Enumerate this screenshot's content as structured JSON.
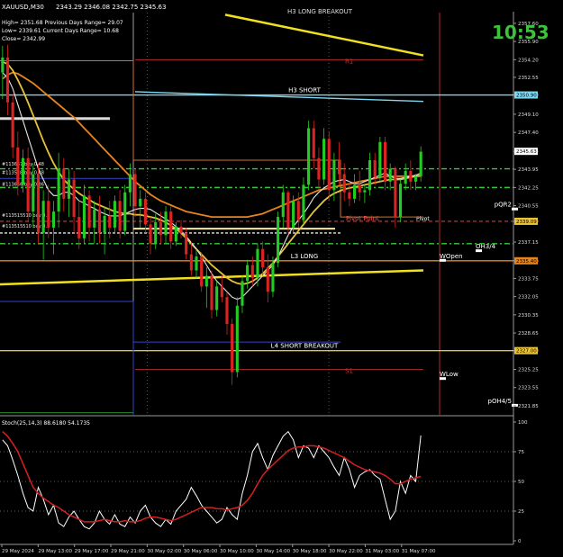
{
  "window": {
    "title": "XAUUSD,M30",
    "ohlc": "2343.29 2346.08 2342.75 2345.63",
    "clock": "10:53"
  },
  "info": {
    "lines": [
      "High= 2351.68   Previous Days Range= 29.07",
      "Low= 2339.61   Current Days Range= 10.68",
      "Close= 2342.99"
    ]
  },
  "colors": {
    "background": "#000000",
    "bull": "#22cc22",
    "bear": "#dd2222",
    "ma_orange": "#e8841e",
    "ma_gold": "#e8c23a",
    "ma_white": "#e6e6e6",
    "yellow_line": "#f0e020",
    "cyan_line": "#7fd8f0",
    "green_dash": "#33cc33",
    "stoch_main": "#ffffff",
    "stoch_signal": "#d42020"
  },
  "chart_data": [
    {
      "type": "line",
      "title": "XAUUSD,M30",
      "x_tick_labels": [
        "29 May 2024",
        "29 May 13:00",
        "29 May 17:00",
        "29 May 21:00",
        "30 May 02:00",
        "30 May 06:00",
        "30 May 10:00",
        "30 May 14:00",
        "30 May 18:00",
        "30 May 22:00",
        "31 May 03:00",
        "31 May 07:00"
      ],
      "y_ticks": [
        "2357.60",
        "2355.90",
        "2354.20",
        "2352.55",
        "2350.90",
        "2349.10",
        "2347.40",
        "2345.63",
        "2343.95",
        "2342.25",
        "2340.55",
        "2339.09",
        "2337.15",
        "2335.40",
        "2333.75",
        "2332.05",
        "2330.35",
        "2328.65",
        "2327.00",
        "2325.25",
        "2323.55",
        "2321.85"
      ],
      "ylim": [
        2321.0,
        2358.6
      ],
      "price_tags": [
        {
          "value": 2350.9,
          "label": "2350.90",
          "color": "#7fd8f0"
        },
        {
          "value": 2345.63,
          "label": "2345.63",
          "color": "#ffffff"
        },
        {
          "value": 2339.09,
          "label": "2339.09",
          "color": "#e8c23a"
        },
        {
          "value": 2335.4,
          "label": "2335.40",
          "color": "#e8841e"
        },
        {
          "value": 2327.0,
          "label": "2327.00",
          "color": "#e8c23a"
        }
      ],
      "candles": [
        [
          2353.0,
          2355.5,
          2350.5,
          2354.4
        ],
        [
          2354.4,
          2355.6,
          2349.0,
          2350.2
        ],
        [
          2350.2,
          2351.0,
          2345.0,
          2346.0
        ],
        [
          2346.0,
          2347.5,
          2341.5,
          2342.5
        ],
        [
          2342.5,
          2345.8,
          2341.8,
          2345.0
        ],
        [
          2345.0,
          2346.0,
          2339.0,
          2340.0
        ],
        [
          2340.0,
          2344.5,
          2338.5,
          2343.5
        ],
        [
          2343.5,
          2344.5,
          2337.0,
          2338.0
        ],
        [
          2338.0,
          2342.0,
          2335.5,
          2341.0
        ],
        [
          2341.0,
          2342.5,
          2337.5,
          2338.5
        ],
        [
          2338.5,
          2341.0,
          2336.0,
          2340.0
        ],
        [
          2340.0,
          2345.5,
          2338.5,
          2344.0
        ],
        [
          2344.0,
          2345.0,
          2340.0,
          2341.2
        ],
        [
          2341.2,
          2344.0,
          2339.5,
          2343.0
        ],
        [
          2343.0,
          2343.8,
          2338.0,
          2339.5
        ],
        [
          2339.5,
          2341.0,
          2336.5,
          2337.5
        ],
        [
          2337.5,
          2342.5,
          2337.0,
          2341.5
        ],
        [
          2341.5,
          2342.0,
          2337.2,
          2338.5
        ],
        [
          2338.5,
          2341.0,
          2337.0,
          2340.2
        ],
        [
          2340.2,
          2341.5,
          2337.0,
          2338.0
        ],
        [
          2338.0,
          2340.5,
          2336.0,
          2339.6
        ],
        [
          2339.6,
          2341.0,
          2337.5,
          2338.5
        ],
        [
          2338.5,
          2341.5,
          2338.0,
          2341.0
        ],
        [
          2341.0,
          2342.0,
          2337.5,
          2338.2
        ],
        [
          2338.2,
          2342.5,
          2337.8,
          2341.8
        ],
        [
          2341.8,
          2344.5,
          2340.5,
          2343.5
        ],
        [
          2343.5,
          2344.0,
          2339.5,
          2340.5
        ],
        [
          2340.5,
          2342.0,
          2338.5,
          2341.2
        ],
        [
          2341.2,
          2341.8,
          2338.0,
          2338.8
        ],
        [
          2338.8,
          2339.5,
          2336.0,
          2337.0
        ],
        [
          2337.0,
          2339.8,
          2336.5,
          2339.0
        ],
        [
          2339.0,
          2340.0,
          2337.0,
          2337.8
        ],
        [
          2337.8,
          2340.5,
          2337.0,
          2340.0
        ],
        [
          2340.0,
          2340.5,
          2336.5,
          2337.2
        ],
        [
          2337.2,
          2339.0,
          2336.8,
          2338.6
        ],
        [
          2338.6,
          2339.2,
          2337.5,
          2338.0
        ],
        [
          2338.0,
          2338.5,
          2335.5,
          2336.0
        ],
        [
          2336.0,
          2337.2,
          2334.0,
          2334.5
        ],
        [
          2334.5,
          2336.5,
          2333.8,
          2335.8
        ],
        [
          2335.8,
          2336.2,
          2332.5,
          2333.0
        ],
        [
          2333.0,
          2334.8,
          2331.0,
          2334.0
        ],
        [
          2334.0,
          2334.5,
          2330.0,
          2330.8
        ],
        [
          2330.8,
          2333.5,
          2330.2,
          2333.0
        ],
        [
          2333.0,
          2334.0,
          2331.5,
          2332.0
        ],
        [
          2332.0,
          2332.5,
          2328.5,
          2329.5
        ],
        [
          2329.5,
          2330.0,
          2323.8,
          2325.0
        ],
        [
          2325.0,
          2332.0,
          2324.5,
          2331.2
        ],
        [
          2331.2,
          2334.0,
          2330.5,
          2333.5
        ],
        [
          2333.5,
          2335.5,
          2332.8,
          2335.0
        ],
        [
          2335.0,
          2335.8,
          2333.0,
          2333.8
        ],
        [
          2333.8,
          2337.0,
          2333.0,
          2336.5
        ],
        [
          2336.5,
          2337.2,
          2334.0,
          2334.8
        ],
        [
          2334.8,
          2336.0,
          2331.5,
          2332.5
        ],
        [
          2332.5,
          2335.8,
          2332.0,
          2335.2
        ],
        [
          2335.2,
          2340.0,
          2334.8,
          2339.5
        ],
        [
          2339.5,
          2342.5,
          2338.5,
          2341.8
        ],
        [
          2341.8,
          2342.0,
          2337.8,
          2338.5
        ],
        [
          2338.5,
          2341.5,
          2338.0,
          2341.0
        ],
        [
          2341.0,
          2341.8,
          2338.5,
          2339.2
        ],
        [
          2339.2,
          2343.2,
          2338.8,
          2342.5
        ],
        [
          2342.5,
          2348.5,
          2342.0,
          2347.8
        ],
        [
          2347.8,
          2348.5,
          2344.0,
          2345.0
        ],
        [
          2345.0,
          2346.0,
          2342.0,
          2343.0
        ],
        [
          2343.0,
          2347.8,
          2342.5,
          2346.8
        ],
        [
          2346.8,
          2347.5,
          2341.0,
          2342.0
        ],
        [
          2342.0,
          2345.5,
          2341.0,
          2344.8
        ],
        [
          2344.8,
          2346.5,
          2342.5,
          2343.5
        ],
        [
          2343.5,
          2344.5,
          2341.0,
          2341.8
        ],
        [
          2341.8,
          2342.8,
          2340.5,
          2341.2
        ],
        [
          2341.2,
          2343.5,
          2340.8,
          2342.5
        ],
        [
          2342.5,
          2343.8,
          2341.0,
          2341.8
        ],
        [
          2341.8,
          2342.5,
          2340.8,
          2342.0
        ],
        [
          2342.0,
          2345.5,
          2341.5,
          2344.8
        ],
        [
          2344.8,
          2345.5,
          2342.5,
          2343.2
        ],
        [
          2343.2,
          2347.0,
          2342.8,
          2346.5
        ],
        [
          2346.5,
          2347.0,
          2342.0,
          2342.8
        ],
        [
          2342.8,
          2344.5,
          2342.0,
          2344.0
        ],
        [
          2344.0,
          2344.2,
          2338.5,
          2339.5
        ],
        [
          2339.5,
          2343.0,
          2339.0,
          2342.6
        ],
        [
          2342.6,
          2344.5,
          2342.0,
          2343.8
        ],
        [
          2343.8,
          2344.8,
          2342.0,
          2342.8
        ],
        [
          2342.8,
          2343.5,
          2342.0,
          2343.3
        ],
        [
          2343.3,
          2346.1,
          2342.8,
          2345.6
        ]
      ],
      "series": [
        {
          "color": "#e8841e",
          "values": [
            2352.4,
            2352.8,
            2353.0,
            2352.9,
            2352.6,
            2352.3,
            2352.0,
            2351.6,
            2351.2,
            2350.8,
            2350.4,
            2350.0,
            2349.6,
            2349.2,
            2348.8,
            2348.3,
            2347.8,
            2347.3,
            2346.8,
            2346.3,
            2345.8,
            2345.3,
            2344.8,
            2344.3,
            2343.8,
            2343.3,
            2342.8,
            2342.4,
            2342.0,
            2341.6,
            2341.3,
            2341.0,
            2340.8,
            2340.6,
            2340.4,
            2340.2,
            2340.0,
            2339.9,
            2339.8,
            2339.7,
            2339.6,
            2339.5,
            2339.5,
            2339.5,
            2339.5,
            2339.5,
            2339.5,
            2339.5,
            2339.5,
            2339.6,
            2339.7,
            2339.8,
            2340.0,
            2340.2,
            2340.4,
            2340.6,
            2340.8,
            2341.0,
            2341.2,
            2341.4,
            2341.6,
            2341.8,
            2342.0,
            2342.1,
            2342.2,
            2342.3,
            2342.4,
            2342.5,
            2342.6,
            2342.7,
            2342.8,
            2342.9,
            2343.0,
            2343.1,
            2343.2,
            2343.3,
            2343.3,
            2343.3,
            2343.3,
            2343.3,
            2343.3,
            2343.3,
            2343.3
          ]
        },
        {
          "color": "#e8c23a",
          "values": [
            2354.0,
            2353.8,
            2353.2,
            2352.3,
            2351.3,
            2350.2,
            2349.0,
            2347.8,
            2346.6,
            2345.5,
            2344.5,
            2343.7,
            2343.0,
            2342.5,
            2342.1,
            2341.7,
            2341.4,
            2341.1,
            2340.8,
            2340.6,
            2340.4,
            2340.2,
            2340.0,
            2339.9,
            2339.8,
            2339.8,
            2339.7,
            2339.7,
            2339.6,
            2339.5,
            2339.4,
            2339.2,
            2339.0,
            2338.7,
            2338.4,
            2338.0,
            2337.5,
            2337.0,
            2336.5,
            2336.0,
            2335.5,
            2335.0,
            2334.6,
            2334.2,
            2333.8,
            2333.5,
            2333.3,
            2333.2,
            2333.3,
            2333.5,
            2333.8,
            2334.2,
            2334.7,
            2335.2,
            2335.8,
            2336.4,
            2337.0,
            2337.6,
            2338.2,
            2338.8,
            2339.4,
            2340.0,
            2340.5,
            2341.0,
            2341.4,
            2341.7,
            2341.9,
            2342.1,
            2342.2,
            2342.3,
            2342.4,
            2342.5,
            2342.6,
            2342.7,
            2342.8,
            2342.9,
            2343.0,
            2343.0,
            2343.0,
            2343.1,
            2343.2,
            2343.3,
            2343.4
          ]
        },
        {
          "color": "#e6e6e6",
          "values": [
            2353.0,
            2352.5,
            2351.5,
            2350.0,
            2348.5,
            2347.0,
            2345.5,
            2344.0,
            2343.0,
            2342.0,
            2341.5,
            2341.5,
            2341.8,
            2341.8,
            2341.5,
            2341.0,
            2340.8,
            2340.5,
            2340.3,
            2340.0,
            2339.8,
            2339.6,
            2339.6,
            2339.6,
            2339.8,
            2340.0,
            2340.2,
            2340.3,
            2340.3,
            2340.2,
            2339.9,
            2339.6,
            2339.3,
            2339.0,
            2338.6,
            2338.2,
            2337.7,
            2337.1,
            2336.5,
            2335.8,
            2335.0,
            2334.2,
            2333.5,
            2333.0,
            2332.5,
            2332.0,
            2331.8,
            2332.0,
            2332.5,
            2333.0,
            2333.5,
            2334.0,
            2334.5,
            2335.0,
            2335.8,
            2336.8,
            2337.8,
            2338.6,
            2339.2,
            2339.8,
            2340.5,
            2341.3,
            2341.8,
            2342.2,
            2342.5,
            2342.8,
            2342.9,
            2343.0,
            2342.8,
            2342.6,
            2342.6,
            2342.8,
            2343.0,
            2343.2,
            2343.4,
            2343.6,
            2343.3,
            2343.1,
            2343.1,
            2343.2,
            2343.3,
            2343.4,
            2343.6
          ]
        }
      ],
      "levels": [
        {
          "label": "H3 SHORT",
          "value": 2350.9,
          "color": "#7fd8f0",
          "style": "solid"
        },
        {
          "label": "L3 LONG",
          "value": 2335.4,
          "color": "#e8841e",
          "style": "solid"
        },
        {
          "label": "L4 SHORT BREAKOUT",
          "value": 2327.0,
          "color": "#e8c23a",
          "style": "solid"
        },
        {
          "label": "Pivot Point",
          "value": 2339.09,
          "color": "#ff5050",
          "style": "dash"
        },
        {
          "label": "Pivot",
          "value": 2339.09,
          "color": "#ff5050",
          "style": "dash"
        },
        {
          "label": "R1",
          "value": 2354.2,
          "color": "#cc3333",
          "style": "short"
        },
        {
          "label": "S1",
          "value": 2325.25,
          "color": "#cc3333",
          "style": "short"
        },
        {
          "label": "WOpen",
          "value": 2335.4,
          "color": "#ffffff",
          "style": "marker"
        },
        {
          "label": "WLow",
          "value": 2324.35,
          "color": "#ffffff",
          "style": "marker"
        },
        {
          "label": "OH3/4",
          "value": 2336.3,
          "color": "#ffffff",
          "style": "marker"
        },
        {
          "label": "pQR2",
          "value": 2340.2,
          "color": "#ffffff",
          "style": "marker"
        },
        {
          "label": "pOH4/5",
          "value": 2321.85,
          "color": "#ffffff",
          "style": "marker"
        }
      ],
      "order_labels": [
        "#113667 buy 0.48",
        "#113528 buy 0.48",
        "#113656 buy 0.36",
        "#113515510 buy 0.0",
        "#113515510 buy 0.0"
      ],
      "top_label": "H3 LONG BREAKOUT"
    },
    {
      "type": "line",
      "title": "Stoch(25,14,3) 88.6180 54.1735",
      "y_ticks": [
        "100",
        "75",
        "50",
        "25",
        "0"
      ],
      "ylim": [
        0,
        100
      ],
      "series": [
        {
          "name": "Main",
          "color": "#ffffff",
          "values": [
            85,
            80,
            68,
            55,
            40,
            28,
            25,
            45,
            35,
            22,
            30,
            15,
            12,
            20,
            25,
            18,
            12,
            10,
            15,
            25,
            18,
            14,
            22,
            14,
            12,
            20,
            15,
            25,
            30,
            20,
            15,
            12,
            18,
            14,
            25,
            30,
            35,
            45,
            38,
            30,
            25,
            20,
            15,
            18,
            28,
            22,
            18,
            40,
            55,
            75,
            82,
            70,
            60,
            72,
            80,
            88,
            92,
            85,
            70,
            80,
            78,
            70,
            80,
            75,
            70,
            62,
            55,
            70,
            60,
            45,
            55,
            58,
            60,
            55,
            52,
            35,
            18,
            25,
            50,
            40,
            55,
            50,
            88.6
          ]
        },
        {
          "name": "Signal",
          "color": "#d42020",
          "values": [
            92,
            88,
            82,
            75,
            65,
            55,
            45,
            40,
            36,
            33,
            30,
            28,
            25,
            22,
            20,
            18,
            16,
            16,
            16,
            17,
            18,
            17,
            16,
            16,
            17,
            16,
            16,
            17,
            19,
            20,
            20,
            19,
            18,
            17,
            18,
            20,
            22,
            24,
            26,
            28,
            28,
            28,
            27,
            27,
            26,
            27,
            28,
            30,
            34,
            40,
            48,
            55,
            60,
            64,
            68,
            72,
            76,
            78,
            79,
            79,
            80,
            80,
            79,
            78,
            76,
            74,
            72,
            70,
            67,
            64,
            62,
            60,
            59,
            58,
            57,
            55,
            52,
            48,
            48,
            50,
            52,
            53,
            54.2
          ]
        }
      ]
    }
  ]
}
